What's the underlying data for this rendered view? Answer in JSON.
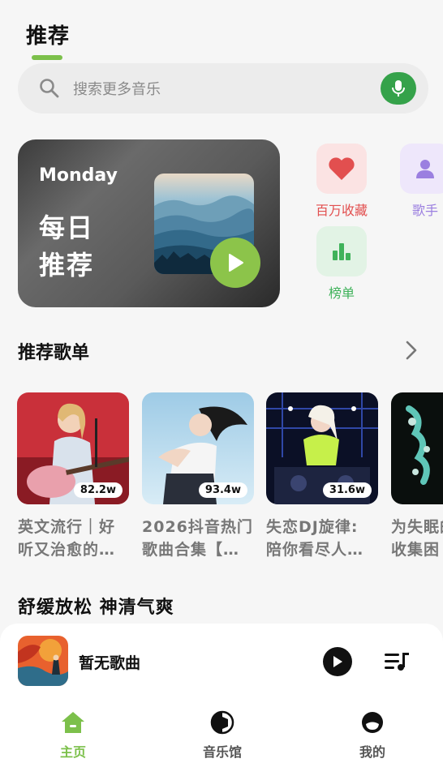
{
  "header": {
    "title": "推荐"
  },
  "search": {
    "placeholder": "搜索更多音乐"
  },
  "daily": {
    "weekday": "Monday",
    "title_line1": "每日",
    "title_line2": "推荐"
  },
  "shortcuts": [
    {
      "label": "百万收藏",
      "icon": "heart-icon",
      "color": "#e24f4f",
      "bg": "#fbe3e3"
    },
    {
      "label": "歌手",
      "icon": "person-icon",
      "color": "#9b7fe0",
      "bg": "#eee7fb"
    },
    {
      "label": "榜单",
      "icon": "chart-bars-icon",
      "color": "#3fb25a",
      "bg": "#e2f3e5"
    }
  ],
  "recommended": {
    "title": "推荐歌单",
    "playlists": [
      {
        "count": "82.2w",
        "title_line1": "英文流行｜好",
        "title_line2": "听又治愈的…"
      },
      {
        "count": "93.4w",
        "title_line1": "2026抖音热门",
        "title_line2": "歌曲合集【…"
      },
      {
        "count": "31.6w",
        "title_line1": "失恋DJ旋律:",
        "title_line2": "陪你看尽人…"
      },
      {
        "count": "",
        "title_line1": "为失眠的",
        "title_line2": "收集困"
      }
    ]
  },
  "section2": {
    "title": "舒缓放松 神清气爽"
  },
  "player": {
    "song": "暂无歌曲"
  },
  "nav": [
    {
      "label": "主页",
      "icon": "home-icon",
      "active": true
    },
    {
      "label": "音乐馆",
      "icon": "music-hall-icon",
      "active": false
    },
    {
      "label": "我的",
      "icon": "profile-icon",
      "active": false
    }
  ],
  "colors": {
    "accent": "#7cc04b",
    "mic": "#35a24a",
    "play": "#8cc44a"
  }
}
